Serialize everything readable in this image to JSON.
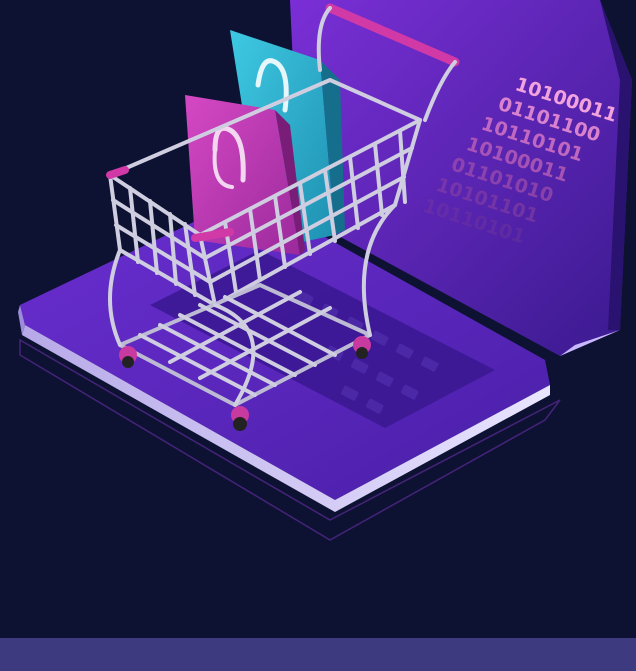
{
  "illustration": {
    "binary_lines": [
      "10100011",
      "01101100",
      "10110101",
      "10100011",
      "01101010",
      "10101101",
      "10110101"
    ],
    "colors": {
      "background": "#0d1233",
      "footer_band": "#3e3a80",
      "laptop_purple": "#5b24c4",
      "bag_magenta": "#c23bb3",
      "bag_cyan": "#2fb6d1",
      "cart_silver": "#c9c7d8",
      "accent_pink": "#d22e9e"
    },
    "icons": [
      "laptop-icon",
      "shopping-cart-icon",
      "shopping-bag-icon"
    ]
  }
}
